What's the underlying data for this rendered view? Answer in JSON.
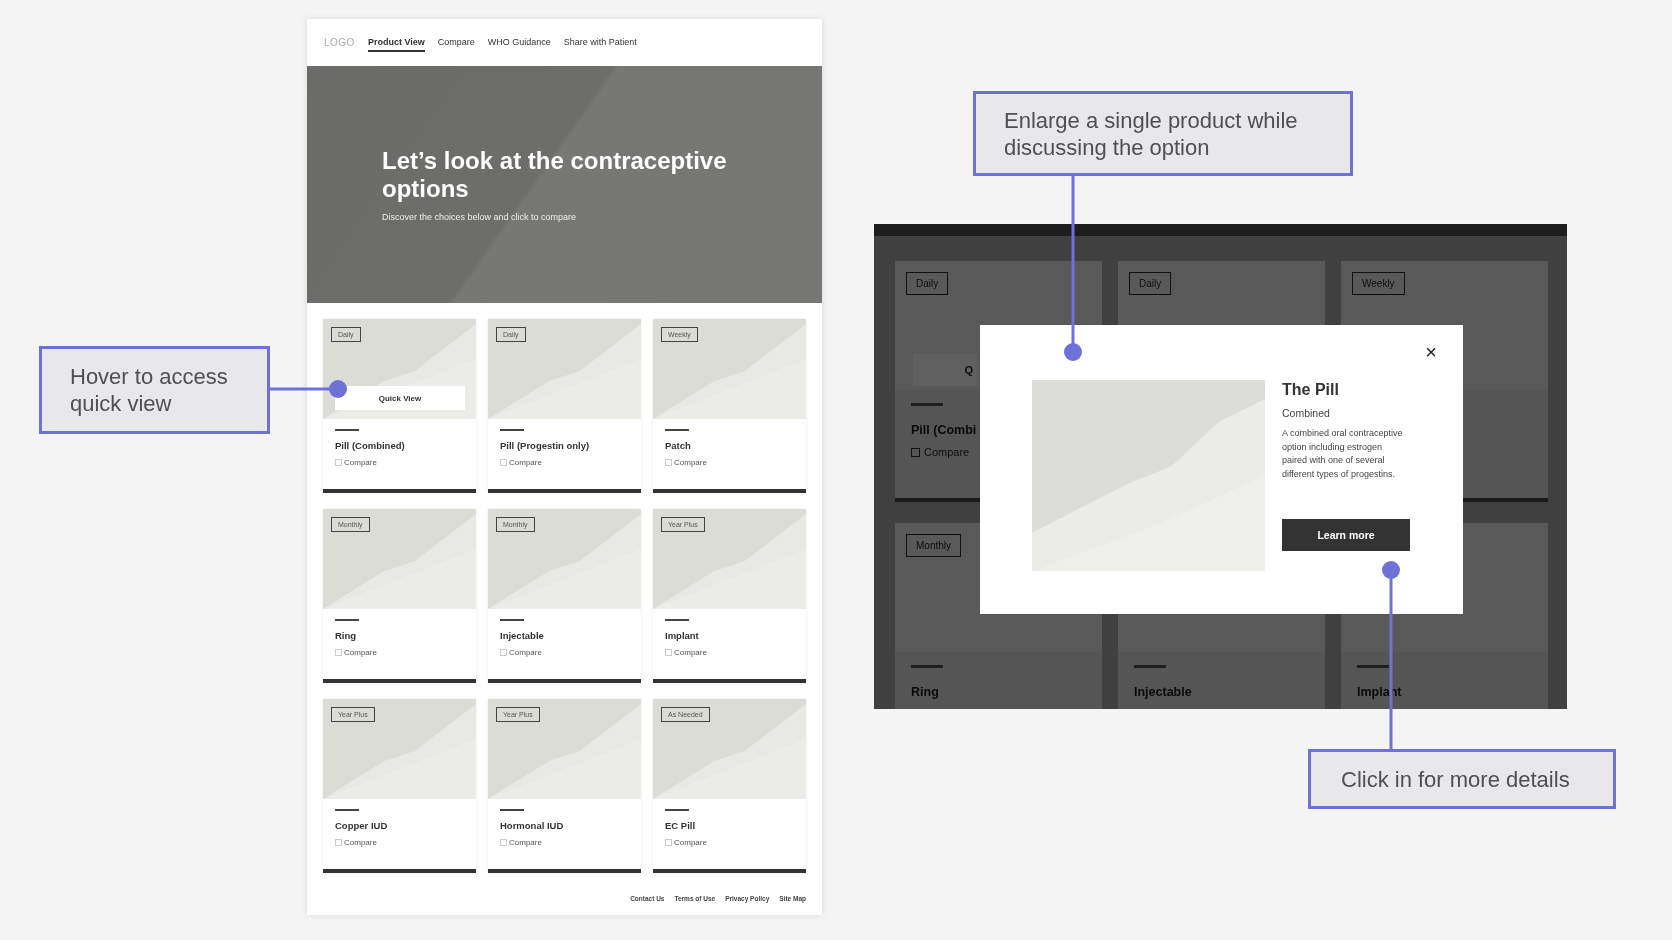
{
  "callouts": [
    {
      "kind": "left",
      "text": "Hover to access quick view"
    },
    {
      "kind": "top",
      "text": "Enlarge a single product while discussing the option"
    },
    {
      "kind": "bottom",
      "text": "Click in for more details"
    }
  ],
  "product_page": {
    "logo": "LOGO",
    "nav": [
      {
        "label": "Product View",
        "selected": true
      },
      {
        "label": "Compare",
        "selected": false
      },
      {
        "label": "WHO Guidance",
        "selected": false
      },
      {
        "label": "Share with Patient",
        "selected": false
      }
    ],
    "hero": {
      "title": "Let’s look at the contraceptive options",
      "subtitle": "Discover the choices below and click to compare"
    },
    "cards": [
      {
        "tag": "Daily",
        "name": "Pill (Combined)",
        "compare": "Compare",
        "checked": false,
        "quick_view": "Quick View"
      },
      {
        "tag": "Daily",
        "name": "Pill (Progestin only)",
        "compare": "Compare",
        "checked": false
      },
      {
        "tag": "Weekly",
        "name": "Patch",
        "compare": "Compare",
        "checked": false
      },
      {
        "tag": "Monthly",
        "name": "Ring",
        "compare": "Compare",
        "checked": false
      },
      {
        "tag": "Monthly",
        "name": "Injectable",
        "compare": "Compare",
        "checked": false
      },
      {
        "tag": "Year Plus",
        "name": "Implant",
        "compare": "Compare",
        "checked": false
      },
      {
        "tag": "Year Plus",
        "name": "Copper IUD",
        "compare": "Compare",
        "checked": false
      },
      {
        "tag": "Year Plus",
        "name": "Hormonal IUD",
        "compare": "Compare",
        "checked": false
      },
      {
        "tag": "As Needed",
        "name": "EC Pill",
        "compare": "Compare",
        "checked": false
      }
    ],
    "footer_links": [
      "Contact Us",
      "Terms of Use",
      "Privacy Policy",
      "Site Map"
    ]
  },
  "modal_view": {
    "background_cards": [
      {
        "tag": "Daily",
        "quick_view": "Q",
        "name": "Pill (Combi",
        "compare": "Compare",
        "checked": false
      },
      {
        "tag": "Daily"
      },
      {
        "tag": "Weekly"
      },
      {
        "tag": "Monthly",
        "name": "Ring"
      },
      {
        "name": "Injectable"
      },
      {
        "name": "Implant"
      }
    ],
    "modal": {
      "close": "×",
      "title": "The Pill",
      "subtitle": "Combined",
      "description": "A combined oral contraceptive option including estrogen paired with one of several different types of progestins.",
      "button": "Learn more"
    }
  }
}
